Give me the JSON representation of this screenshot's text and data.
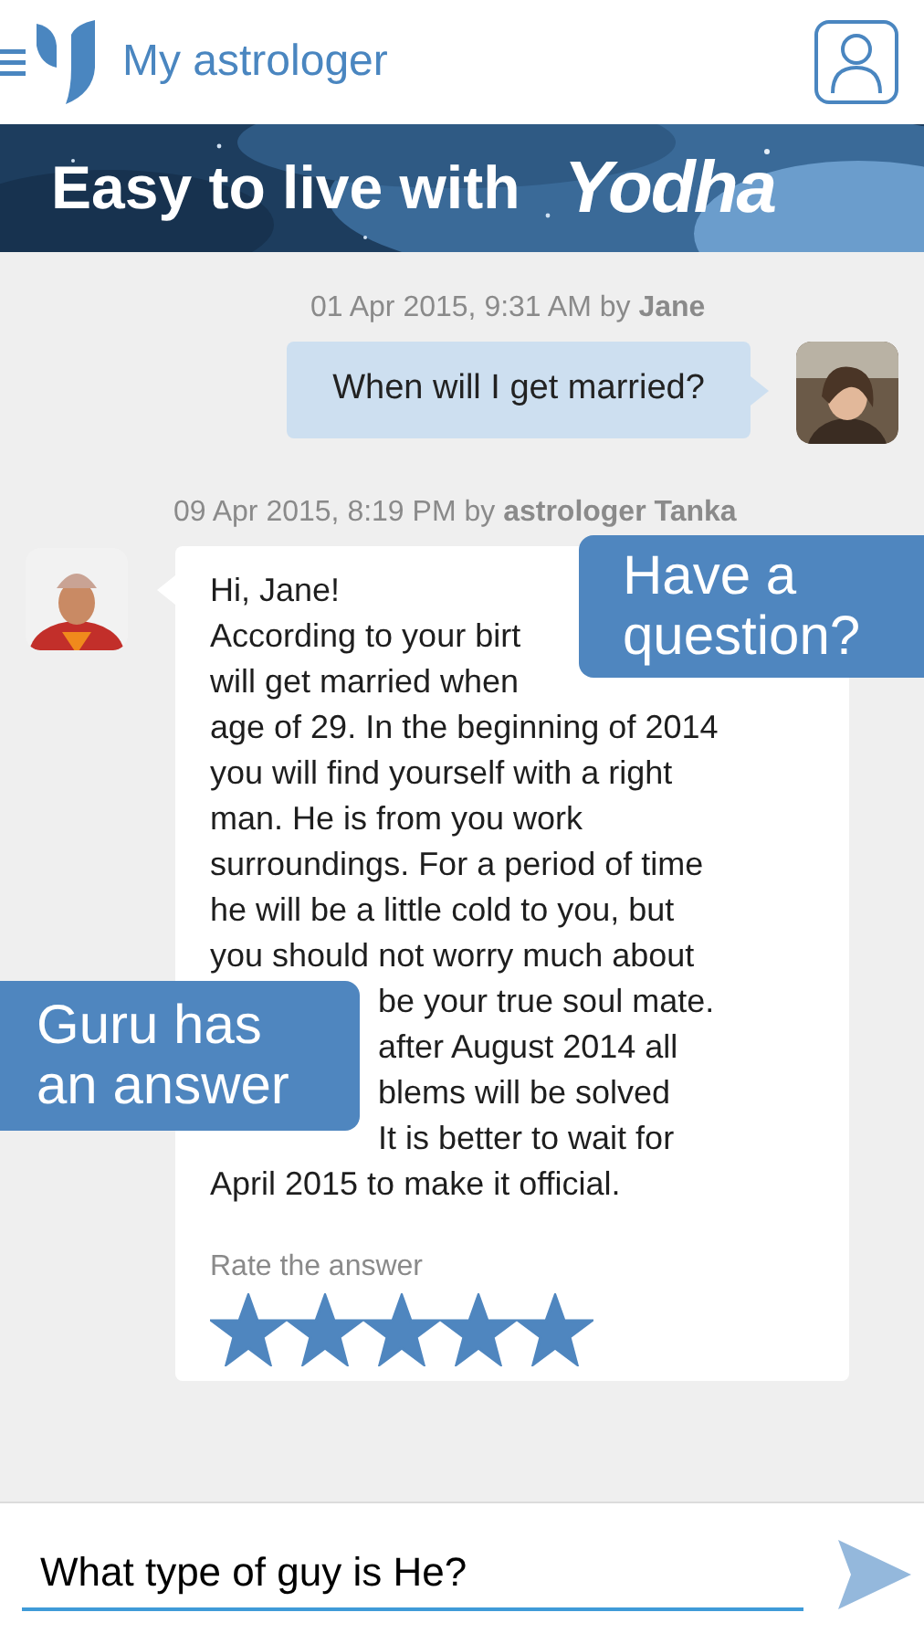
{
  "app_bar": {
    "title": "My astrologer"
  },
  "banner": {
    "kind": "picture",
    "tagline": "Easy to live with",
    "brand": "Yodha"
  },
  "messages": [
    {
      "kind": "question",
      "meta": "01 Apr 2015, 9:31 AM by **Jane**",
      "text": "When will I get married?"
    },
    {
      "kind": "answer",
      "meta": "09 Apr 2015, 8:19 PM by **astrologer Tanka**",
      "lines": [
        {
          "kind": "full",
          "text": "Hi, Jane!"
        },
        {
          "kind": "full",
          "text": "According to your birt"
        },
        {
          "kind": "full",
          "text": "will get married when"
        },
        {
          "kind": "full",
          "text": "age of 29. In the beginning of 2014"
        },
        {
          "kind": "full",
          "text": "you will find yourself with a right"
        },
        {
          "kind": "full",
          "text": "man. He is from you work"
        },
        {
          "kind": "full",
          "text": "surroundings. For a period of time"
        },
        {
          "kind": "full",
          "text": "he will be a little cold to you, but"
        },
        {
          "kind": "full",
          "text": "you should not worry much about"
        },
        {
          "kind": "cut_left",
          "text": "be your true soul mate."
        },
        {
          "kind": "cut_left",
          "text": "after August 2014 all"
        },
        {
          "kind": "cut_left",
          "text": "blems will be solved"
        },
        {
          "kind": "cut_left",
          "text": "It is better to wait for"
        },
        {
          "kind": "full",
          "text": "April 2015 to make it official."
        }
      ],
      "rating": {
        "label": "Rate the answer",
        "stars": 5
      }
    }
  ],
  "callouts": [
    {
      "kind": "right",
      "text": "Have a question?"
    },
    {
      "kind": "left",
      "text": "Guru has an answer"
    }
  ],
  "composer": {
    "value": "What type of guy is He?"
  }
}
